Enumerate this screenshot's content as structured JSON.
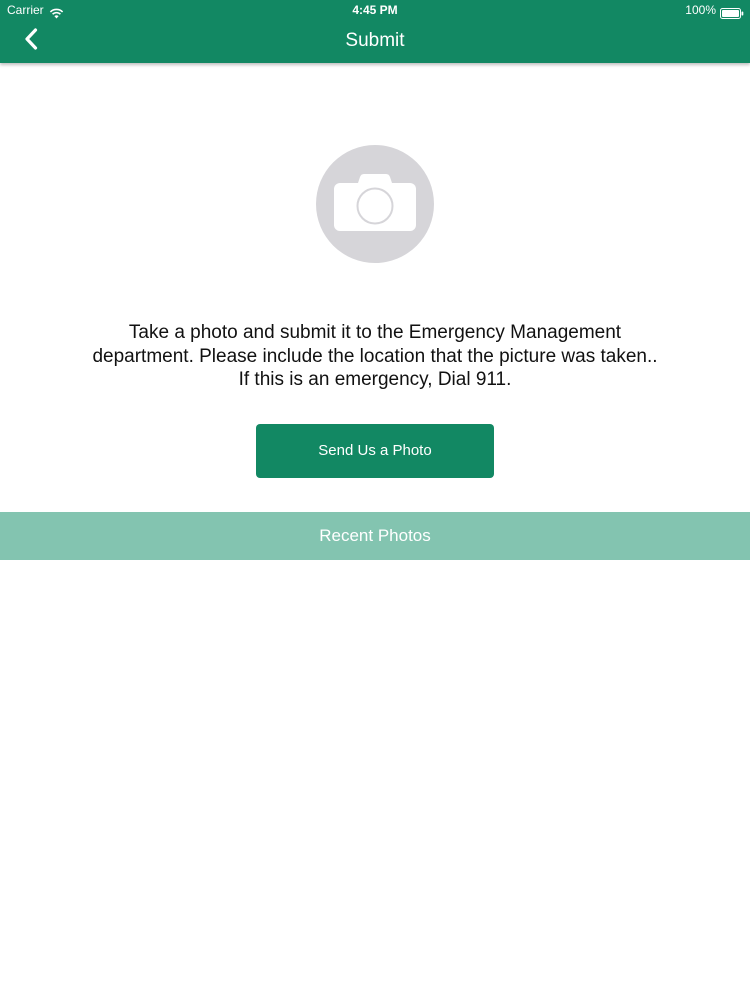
{
  "status_bar": {
    "carrier": "Carrier",
    "time": "4:45 PM",
    "battery": "100%",
    "wifi_icon": "wifi-icon",
    "battery_icon": "battery-icon"
  },
  "nav": {
    "title": "Submit",
    "back_icon": "chevron-left-icon"
  },
  "main": {
    "camera_icon": "camera-icon",
    "instructions": "Take a photo and submit it to the Emergency Management department.  Please include the location that the picture was taken..  If this is an emergency, Dial 911.",
    "send_button_label": "Send Us a Photo",
    "recent_header": "Recent Photos"
  },
  "colors": {
    "brand_green": "#128863",
    "light_green": "#83c4b0",
    "placeholder_gray": "#d6d5d9"
  }
}
